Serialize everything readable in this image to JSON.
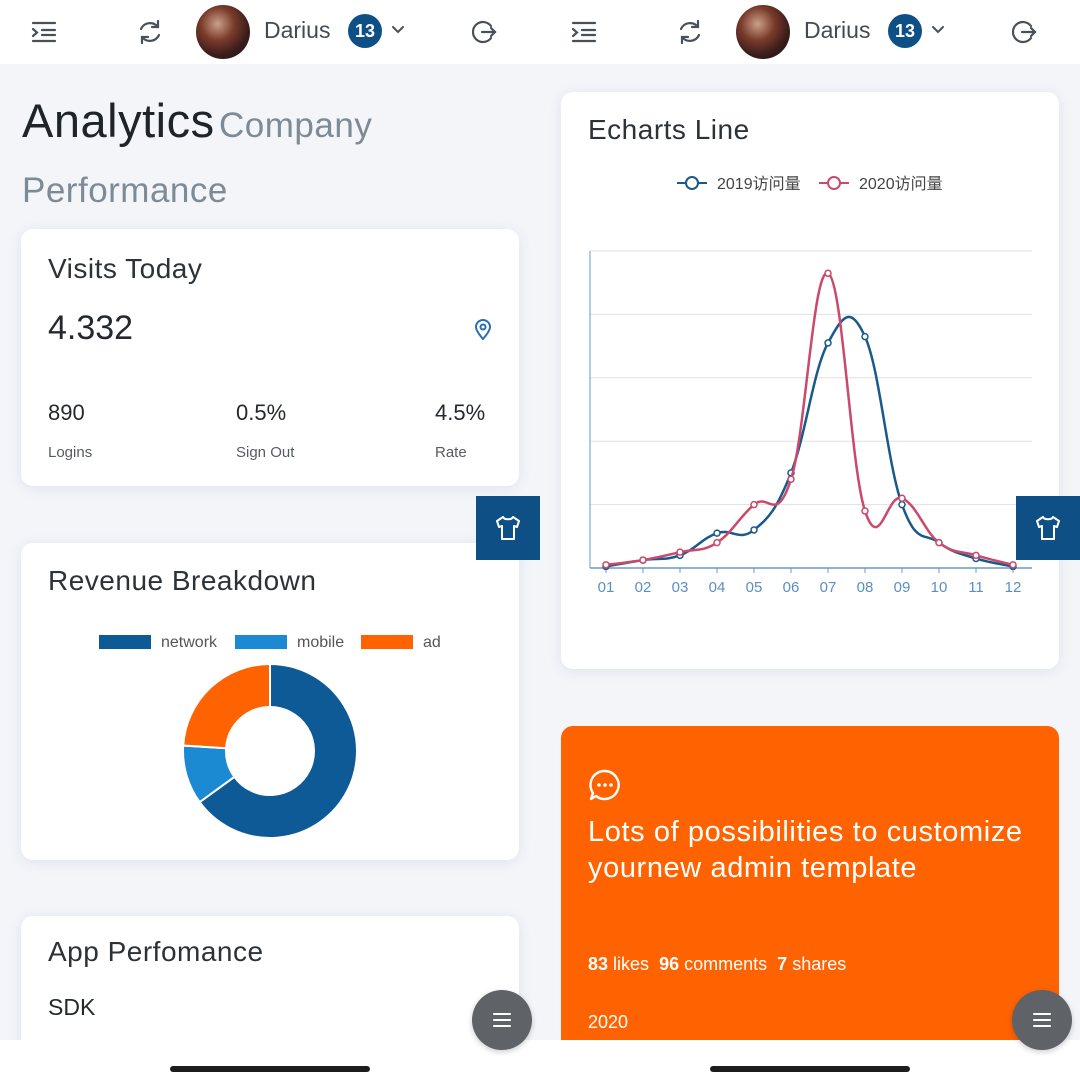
{
  "header": {
    "user_name": "Darius",
    "notification_count": "13",
    "icons": [
      "menu-indent-icon",
      "refresh-icon",
      "chevron-down-icon",
      "logout-icon"
    ]
  },
  "left": {
    "title_main": "Analytics",
    "title_sub_1": "Company",
    "title_sub_2": "Performance",
    "visits": {
      "title": "Visits Today",
      "value": "4.332",
      "stats": [
        {
          "value": "890",
          "label": "Logins"
        },
        {
          "value": "0.5%",
          "label": "Sign Out"
        },
        {
          "value": "4.5%",
          "label": "Rate"
        }
      ]
    },
    "revenue": {
      "title": "Revenue Breakdown",
      "legend": [
        "network",
        "mobile",
        "ad"
      ]
    },
    "app": {
      "title": "App Perfomance",
      "subtitle": "SDK"
    }
  },
  "right": {
    "chart_title": "Echarts Line",
    "promo": {
      "text": "Lots of possibilities to customize yournew admin template",
      "likes_count": "83",
      "likes_label": "likes",
      "comments_count": "96",
      "comments_label": "comments",
      "shares_count": "7",
      "shares_label": "shares",
      "year": "2020"
    }
  },
  "colors": {
    "primary": "#0e4f86",
    "network": "#0e5a96",
    "mobile": "#1c8ad2",
    "ad": "#ff6200",
    "line2019": "#1a5a8a",
    "line2020": "#c94a6a",
    "promo": "#ff6200"
  },
  "chart_data": [
    {
      "type": "pie",
      "title": "Revenue Breakdown",
      "categories": [
        "network",
        "mobile",
        "ad"
      ],
      "values": [
        65,
        11,
        24
      ],
      "legend": "top"
    },
    {
      "type": "line",
      "title": "Echarts Line",
      "categories": [
        "01",
        "02",
        "03",
        "04",
        "05",
        "06",
        "07",
        "08",
        "09",
        "10",
        "11",
        "12"
      ],
      "series": [
        {
          "name": "2019访问量",
          "values": [
            0.5,
            2.5,
            4,
            11,
            12,
            30,
            71,
            73,
            20,
            8,
            3,
            0.5
          ]
        },
        {
          "name": "2020访问量",
          "values": [
            1,
            2.5,
            5,
            8,
            20,
            28,
            93,
            18,
            22,
            8,
            4,
            1
          ]
        }
      ],
      "ylim": [
        0,
        100
      ],
      "grid": true,
      "legend": "top-center"
    }
  ]
}
